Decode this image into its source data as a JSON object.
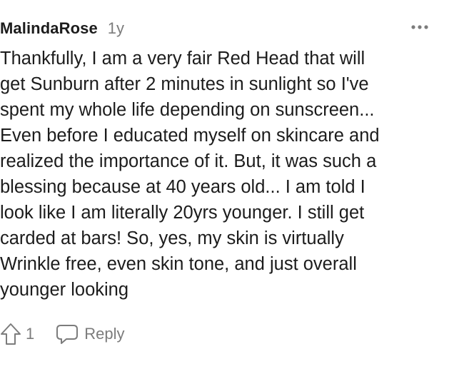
{
  "comment": {
    "author": "MalindaRose",
    "age": "1y",
    "body": "Thankfully, I am a very fair Red Head that will\nget Sunburn after 2 minutes in sunlight so I've\nspent my whole life depending on sunscreen...\nEven before I educated myself on skincare and\nrealized the importance of it. But, it was such a\nblessing because at 40 years old... I am told I\nlook like I am literally 20yrs younger. I still get\ncarded at bars! So, yes, my skin is virtually\nWrinkle free, even skin tone, and just overall\nyounger looking",
    "upvotes": "1",
    "reply_label": "Reply"
  },
  "icons": {
    "more": "more-options-icon",
    "upvote": "upvote-arrow-icon",
    "reply": "speech-bubble-icon"
  },
  "colors": {
    "text": "#1c1c1c",
    "muted": "#7c7c7c"
  }
}
